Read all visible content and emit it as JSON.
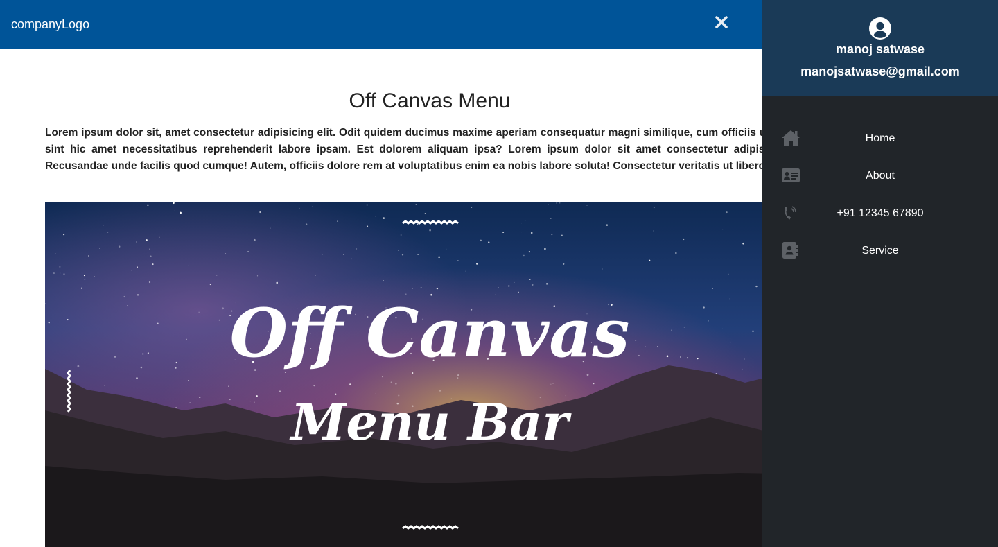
{
  "navbar": {
    "logo_text": "companyLogo",
    "close_icon": "close-icon"
  },
  "main": {
    "title": "Off Canvas Menu",
    "paragraph": "Lorem ipsum dolor sit, amet consectetur adipisicing elit. Odit quidem ducimus maxime aperiam consequatur magni similique, cum officiis ut et natus sint hic amet necessitatibus reprehenderit labore ipsam. Est dolorem aliquam ipsa? Lorem ipsum dolor sit amet consectetur adipisicing elit. Recusandae unde facilis quod cumque! Autem, officiis dolore rem at voluptatibus enim ea nobis labore soluta! Consectetur veritatis ut libero rem?",
    "banner": {
      "line1": "Off Canvas",
      "line2": "Menu Bar"
    }
  },
  "sidebar": {
    "profile": {
      "avatar_icon": "user-circle-icon",
      "name": "manoj satwase",
      "email": "manojsatwase@gmail.com"
    },
    "items": [
      {
        "label": "Home",
        "icon": "home-icon"
      },
      {
        "label": "About",
        "icon": "id-card-icon"
      },
      {
        "label": "+91 12345 67890",
        "icon": "phone-icon"
      },
      {
        "label": "Service",
        "icon": "address-book-icon"
      }
    ]
  },
  "colors": {
    "navbar_bg": "#005498",
    "sidebar_bg": "#212529",
    "profile_bg": "#1a3a57",
    "icon_muted": "#5d6166"
  }
}
